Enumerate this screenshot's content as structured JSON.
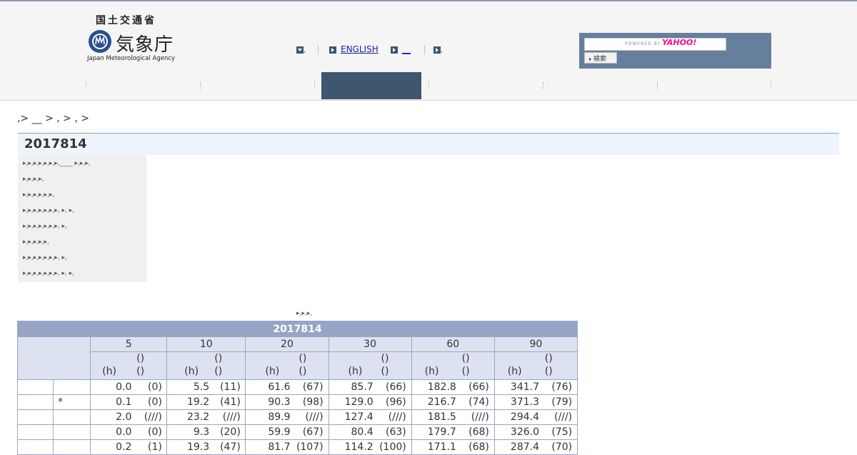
{
  "header": {
    "logo_top": "国土交通省",
    "logo_name": "気象庁",
    "logo_en": "Japan Meteorological Agency",
    "links": [
      {
        "label": "",
        "icon": "chevron-down-icon"
      },
      {
        "label": "ENGLISH",
        "icon": "arrow-right-icon"
      },
      {
        "label": "__",
        "icon": "arrow-right-icon"
      },
      {
        "label": "",
        "icon": "arrow-right-icon"
      }
    ],
    "search": {
      "powered_by": "POWERED BY",
      "provider": "YAHOO!",
      "button_label": "検索"
    }
  },
  "breadcrumb": ",> __ > , > , >",
  "page_title": "2017814",
  "sidebar_lines": [
    ",,,,,,,____ ,,,",
    ",,,,",
    ",,,,,,",
    ",,,,,,, , ,",
    ",,,,,,, ,",
    ",,,,,",
    ",,,,,,, ,",
    ",,,,,,, , ,"
  ],
  "note_line": ",,,",
  "table": {
    "caption": "2017814",
    "durations": [
      "5",
      "10",
      "20",
      "30",
      "60",
      "90"
    ],
    "sub_top": "()",
    "sub_h": "(h)",
    "sub_rank": "()",
    "rows": [
      {
        "mark": "",
        "cells": [
          [
            "0.0",
            "(0)"
          ],
          [
            "5.5",
            "(11)"
          ],
          [
            "61.6",
            "(67)"
          ],
          [
            "85.7",
            "(66)"
          ],
          [
            "182.8",
            "(66)"
          ],
          [
            "341.7",
            "(76)"
          ]
        ]
      },
      {
        "mark": "*",
        "cells": [
          [
            "0.1",
            "(0)"
          ],
          [
            "19.2",
            "(41)"
          ],
          [
            "90.3",
            "(98)"
          ],
          [
            "129.0",
            "(96)"
          ],
          [
            "216.7",
            "(74)"
          ],
          [
            "371.3",
            "(79)"
          ]
        ]
      },
      {
        "mark": "",
        "cells": [
          [
            "2.0",
            "(///)"
          ],
          [
            "23.2",
            "(///)"
          ],
          [
            "89.9",
            "(///)"
          ],
          [
            "127.4",
            "(///)"
          ],
          [
            "181.5",
            "(///)"
          ],
          [
            "294.4",
            "(///)"
          ]
        ]
      },
      {
        "mark": "",
        "cells": [
          [
            "0.0",
            "(0)"
          ],
          [
            "9.3",
            "(20)"
          ],
          [
            "59.9",
            "(67)"
          ],
          [
            "80.4",
            "(63)"
          ],
          [
            "179.7",
            "(68)"
          ],
          [
            "326.0",
            "(75)"
          ]
        ]
      },
      {
        "mark": "",
        "cells": [
          [
            "0.2",
            "(1)"
          ],
          [
            "19.3",
            "(47)"
          ],
          [
            "81.7",
            "(107)"
          ],
          [
            "114.2",
            "(100)"
          ],
          [
            "171.1",
            "(68)"
          ],
          [
            "287.4",
            "(70)"
          ]
        ]
      }
    ]
  },
  "colors": {
    "nav_active": "#3e566e",
    "search_panel": "#667f9d",
    "table_caption": "#98a4c6",
    "table_header": "#dce2ef",
    "link": "#1a1aa6"
  }
}
